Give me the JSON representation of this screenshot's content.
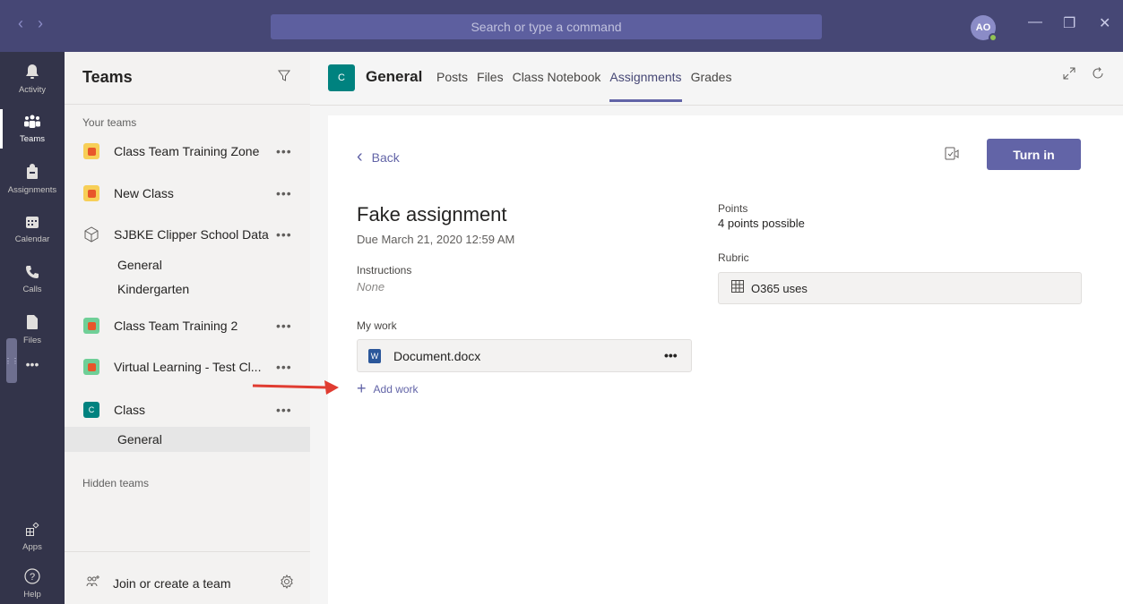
{
  "titlebar": {
    "back": "‹",
    "forward": "›",
    "search_placeholder": "Search or type a command",
    "avatar_initials": "AO",
    "minimize": "—",
    "restore": "❐",
    "close": "✕"
  },
  "appbar": {
    "items": [
      {
        "label": "Activity",
        "icon": "bell-icon",
        "glyph": "🔔"
      },
      {
        "label": "Teams",
        "icon": "teams-icon",
        "glyph": "⁘"
      },
      {
        "label": "Assignments",
        "icon": "assignments-icon",
        "glyph": "🎒"
      },
      {
        "label": "Calendar",
        "icon": "calendar-icon",
        "glyph": "▦"
      },
      {
        "label": "Calls",
        "icon": "phone-icon",
        "glyph": "✆"
      },
      {
        "label": "Files",
        "icon": "file-icon",
        "glyph": "▮"
      },
      {
        "label": "",
        "icon": "more-icon",
        "glyph": "•••"
      },
      {
        "label": "Apps",
        "icon": "apps-icon",
        "glyph": "⊞"
      },
      {
        "label": "Help",
        "icon": "help-icon",
        "glyph": "ⓘ"
      }
    ]
  },
  "teams_panel": {
    "title": "Teams",
    "your_teams_label": "Your teams",
    "teams": [
      {
        "name": "Class Team Training Zone",
        "more": "•••"
      },
      {
        "name": "New Class",
        "more": "•••"
      },
      {
        "name": "SJBKE Clipper School Data",
        "more": "•••"
      },
      {
        "name": "Class Team Training 2",
        "more": "•••"
      },
      {
        "name": "Virtual Learning - Test Cl...",
        "more": "•••"
      },
      {
        "name": "Class",
        "more": "•••",
        "tile_letter": "C"
      }
    ],
    "channels": {
      "sjbke_general": "General",
      "sjbke_kindergarten": "Kindergarten",
      "class_general": "General"
    },
    "hidden_teams_label": "Hidden teams",
    "join_label": "Join or create a team"
  },
  "channel_header": {
    "tile_letter": "C",
    "name": "General",
    "tabs": [
      "Posts",
      "Files",
      "Class Notebook",
      "Assignments",
      "Grades"
    ],
    "active_tab": "Assignments"
  },
  "assignment": {
    "back_label": "Back",
    "turn_in_label": "Turn in",
    "title": "Fake assignment",
    "due": "Due March 21, 2020 12:59 AM",
    "instructions_label": "Instructions",
    "instructions_value": "None",
    "my_work_label": "My work",
    "document_name": "Document.docx",
    "document_more": "•••",
    "add_work_label": "Add work",
    "points_label": "Points",
    "points_value": "4 points possible",
    "rubric_label": "Rubric",
    "rubric_name": "O365 uses"
  },
  "colors": {
    "titlebar": "#464775",
    "appbar": "#33344a",
    "accent": "#6264a7",
    "annotation_arrow": "#e03c31"
  }
}
